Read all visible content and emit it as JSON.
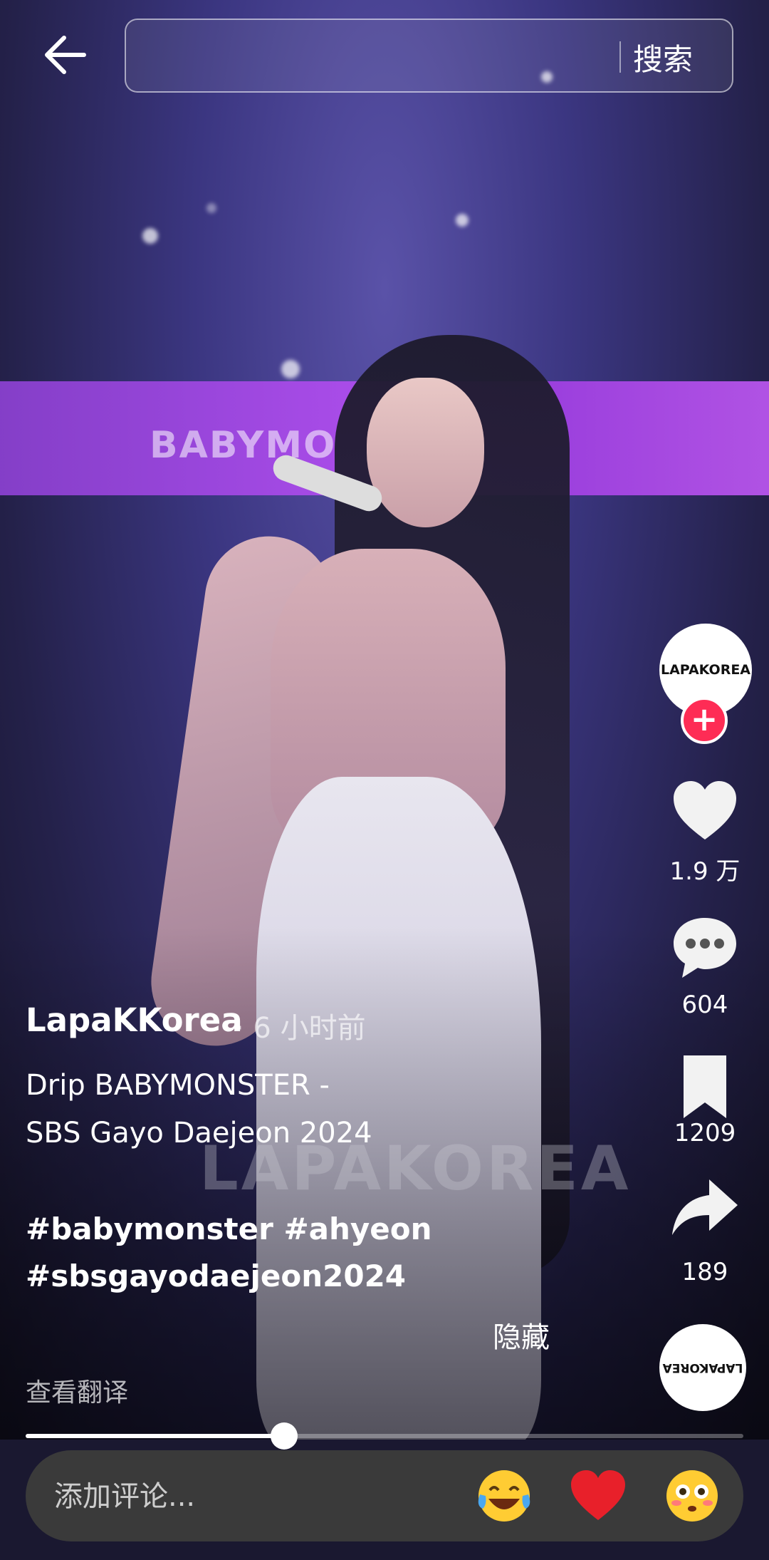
{
  "search": {
    "placeholder": "",
    "button_label": "搜索"
  },
  "video": {
    "banner_text": "BABYMO",
    "watermark": "LAPAKOREA"
  },
  "creator": {
    "avatar_text": "LAPAKOREA",
    "name": "LapaKKorea",
    "time": "· 6 小时前"
  },
  "actions": {
    "likes": "1.9 万",
    "comments": "604",
    "saves": "1209",
    "shares": "189"
  },
  "caption": {
    "line1": "Drip BABYMONSTER -",
    "line2": "SBS Gayo Daejeon 2024",
    "hashtags_line1": "#babymonster #ahyeon",
    "hashtags_line2": "#sbsgayodaejeon2024"
  },
  "hide_label": "隐藏",
  "translate_label": "查看翻译",
  "progress": {
    "fraction": 0.36
  },
  "comment": {
    "placeholder": "添加评论...",
    "quick_emojis": [
      "laughing-tears",
      "red-heart",
      "flushed-face"
    ]
  },
  "colors": {
    "follow_accent": "#fe2c55",
    "comment_bar": "#3a3a3a"
  }
}
